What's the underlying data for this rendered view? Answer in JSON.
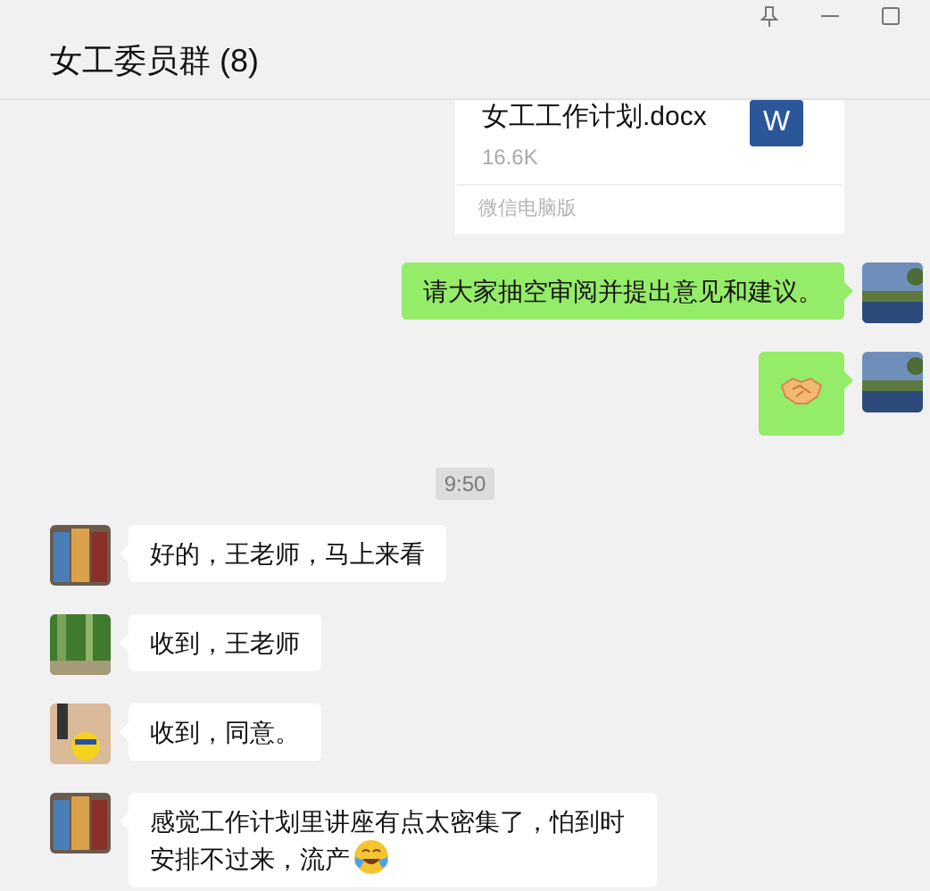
{
  "window": {
    "title": "女工委员群 (8)",
    "controls": [
      {
        "kind": "pin"
      },
      {
        "kind": "minimize"
      },
      {
        "kind": "maximize"
      }
    ]
  },
  "messages": [
    {
      "kind": "file",
      "outgoing": true,
      "file_name": "女工工作计划.docx",
      "size": "16.6K",
      "source": "微信电脑版",
      "file_badge": "W"
    },
    {
      "kind": "text",
      "outgoing": true,
      "text": "请大家抽空审阅并提出意见和建议。",
      "emoji_after": false
    },
    {
      "kind": "emoji",
      "outgoing": true
    },
    {
      "kind": "time",
      "text": "9:50"
    },
    {
      "kind": "text",
      "outgoing": false,
      "text": "好的，王老师，马上来看",
      "emoji_after": false
    },
    {
      "kind": "text",
      "outgoing": false,
      "text": "收到，王老师",
      "emoji_after": false
    },
    {
      "kind": "text",
      "outgoing": false,
      "text": "收到，同意。",
      "emoji_after": false
    },
    {
      "kind": "text",
      "outgoing": false,
      "text": "感觉工作计划里讲座有点太密集了，怕到时安排不过来，流产",
      "emoji_after": true
    }
  ]
}
